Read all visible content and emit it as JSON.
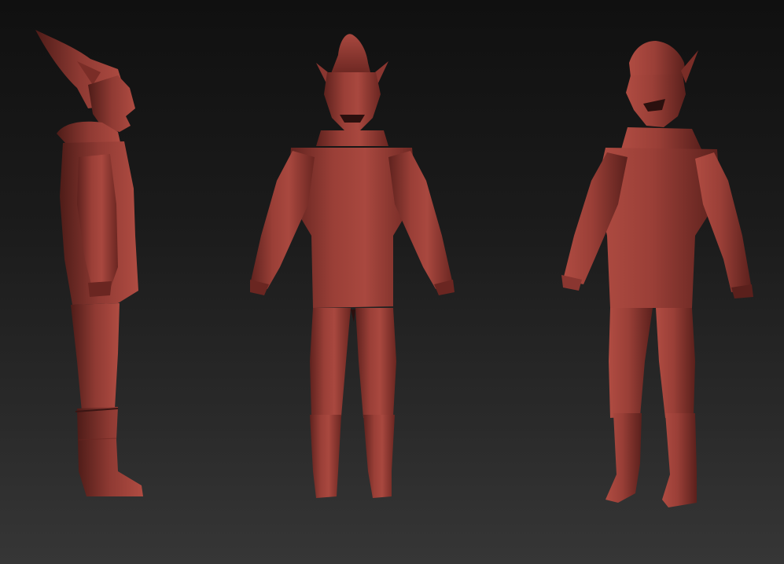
{
  "scene": {
    "background_top": "#101010",
    "background_bottom": "#363636",
    "clay_color": "#8f3a33",
    "clay_light": "#a9483f",
    "clay_dark": "#5e221e",
    "clay_shadow": "#3a1513"
  },
  "views": [
    {
      "view": "side",
      "facing": "right"
    },
    {
      "view": "front",
      "facing": "viewer"
    },
    {
      "view": "three-quarter",
      "facing": "left"
    }
  ]
}
